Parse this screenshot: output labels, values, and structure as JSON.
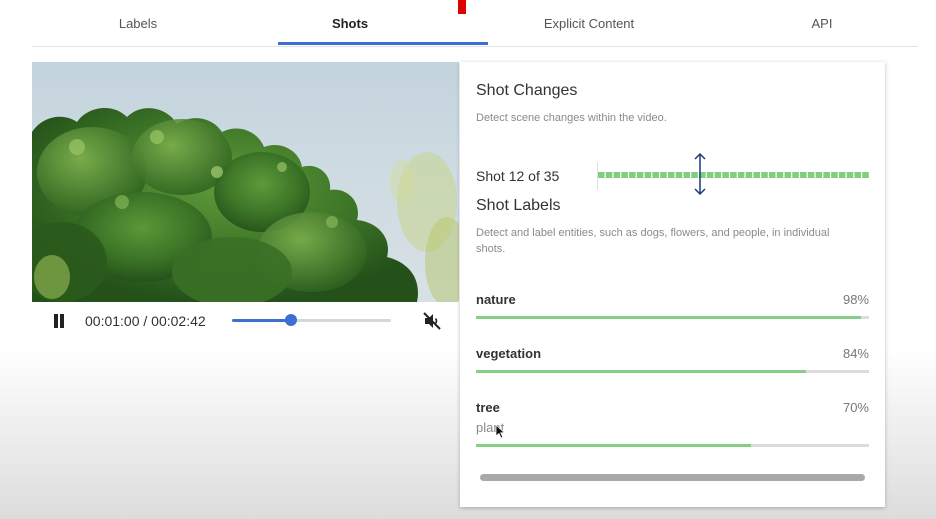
{
  "tabs": [
    {
      "label": "Labels",
      "active": false
    },
    {
      "label": "Shots",
      "active": true
    },
    {
      "label": "Explicit Content",
      "active": false
    },
    {
      "label": "API",
      "active": false
    }
  ],
  "player": {
    "state": "playing",
    "current_time": "00:01:00",
    "duration": "00:02:42",
    "time_display": "00:01:00 / 00:02:42",
    "progress_fraction": 0.37,
    "muted": true,
    "icons": {
      "pause": "pause-icon",
      "mute": "volume-off-icon"
    }
  },
  "shot_changes": {
    "title": "Shot Changes",
    "description": "Detect scene changes within the video.",
    "counter": "Shot 12 of 35",
    "current_shot": 12,
    "total_shots": 35,
    "accent_color": "#7fcf7f"
  },
  "shot_labels": {
    "title": "Shot Labels",
    "description": "Detect and label entities, such as dogs, flowers, and people, in individual shots.",
    "items": [
      {
        "name": "nature",
        "percent_text": "98%",
        "confidence": 0.98,
        "sub": ""
      },
      {
        "name": "vegetation",
        "percent_text": "84%",
        "confidence": 0.84,
        "sub": ""
      },
      {
        "name": "tree",
        "percent_text": "70%",
        "confidence": 0.7,
        "sub": "plant"
      }
    ]
  },
  "colors": {
    "accent_blue": "#3d6fd1",
    "bar_green": "#86cd86",
    "recording_red": "#e00000"
  }
}
